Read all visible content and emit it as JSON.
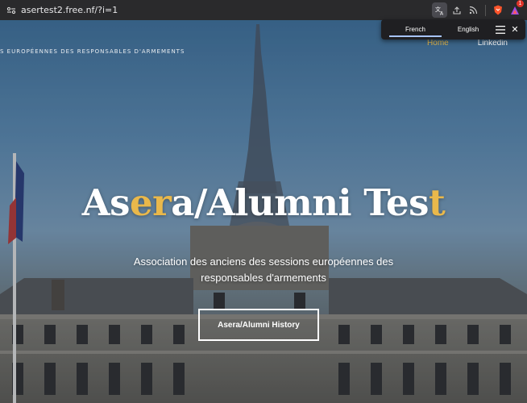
{
  "browser": {
    "url": "asertest2.free.nf/?i=1",
    "brave_badge_count": "1"
  },
  "translate_popup": {
    "languages": [
      "French",
      "English"
    ],
    "selected": "French"
  },
  "site": {
    "tagline": "S EUROPÉENNES DES RESPONSABLES D'ARMEMENTS",
    "nav": {
      "home": "Home",
      "linkedin": "Linkedin"
    },
    "hero": {
      "title_parts": [
        "As",
        "er",
        "a/Alumni Tes",
        "t"
      ],
      "subtitle_line1": "Association des anciens des sessions européennes des",
      "subtitle_line2": "responsables d'armements",
      "cta_label": "Asera/Alumni History"
    }
  },
  "colors": {
    "accent_gold": "#e9b84b",
    "nav_active": "#e6b84a"
  }
}
